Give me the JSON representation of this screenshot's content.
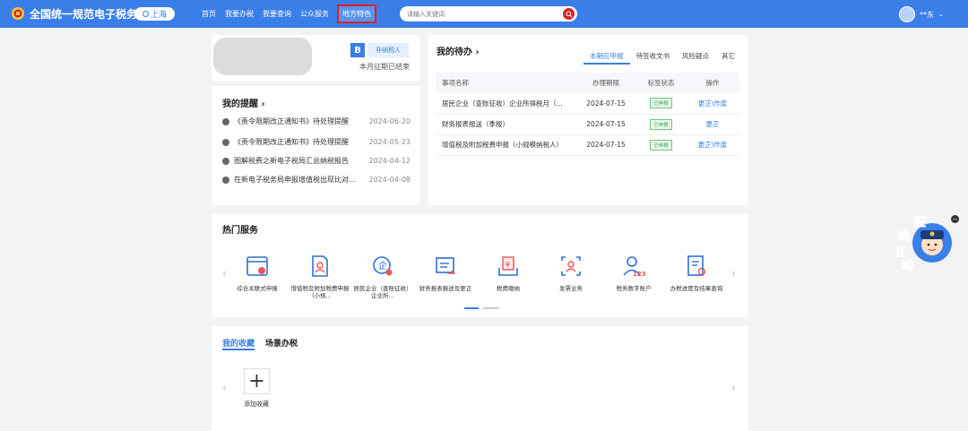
{
  "header": {
    "site_title": "全国统一规范电子税务局",
    "region": "上海",
    "nav": [
      "首页",
      "我要办税",
      "我要查询",
      "公众服务",
      "地方特色"
    ],
    "search_placeholder": "请输入关键词",
    "user_name": "**东"
  },
  "profile": {
    "level": "B",
    "taxpayer_type": "非纳税人",
    "period_status": "本月征期已结束"
  },
  "reminders": {
    "title": "我的提醒 ›",
    "items": [
      {
        "title": "《责令限期改正通知书》待处理提醒",
        "date": "2024-06-20"
      },
      {
        "title": "《责令限期改正通知书》待处理提醒",
        "date": "2024-05-23"
      },
      {
        "title": "图解税费之新电子税局汇总纳税报告",
        "date": "2024-04-12"
      },
      {
        "title": "在新电子税务局申报增值税出现比对...",
        "date": "2024-04-08"
      }
    ]
  },
  "todo": {
    "title": "我的待办 ›",
    "tabs": [
      "本期应申报",
      "待签收文书",
      "风险疑点",
      "其它"
    ],
    "columns": [
      "事项名称",
      "办理期限",
      "标签状态",
      "操作"
    ],
    "rows": [
      {
        "name": "居民企业（查账征收）企业所得税月（...",
        "deadline": "2024-07-15",
        "status": "已申报",
        "action": "更正\\作废"
      },
      {
        "name": "财务报表报送（季报）",
        "deadline": "2024-07-15",
        "status": "已申报",
        "action": "更正"
      },
      {
        "name": "增值税及附加税费申报（小规模纳税人）",
        "deadline": "2024-07-15",
        "status": "已申报",
        "action": "更正\\作废"
      }
    ]
  },
  "hot_services": {
    "title": "热门服务",
    "items": [
      {
        "label": "综合关联式申报",
        "icon": "integrated-declaration-icon"
      },
      {
        "label": "增值税及附加税费申报（小规...",
        "icon": "vat-declaration-icon"
      },
      {
        "label": "居民企业（查账征收）企业所...",
        "icon": "enterprise-income-tax-icon"
      },
      {
        "label": "财务报表报送及更正",
        "icon": "financial-report-icon"
      },
      {
        "label": "税费缴纳",
        "icon": "tax-payment-icon"
      },
      {
        "label": "发票业务",
        "icon": "invoice-icon"
      },
      {
        "label": "税务数字账户",
        "icon": "digital-account-icon"
      },
      {
        "label": "办税进度及结果查询",
        "icon": "progress-query-icon"
      }
    ]
  },
  "favorites": {
    "tabs": [
      "我的收藏",
      "场景办税"
    ],
    "add_label": "添加收藏"
  },
  "float_widget": {
    "chars": [
      "征",
      "纳",
      "互",
      "动"
    ]
  },
  "colors": {
    "brand": "#3a7ee8",
    "highlight": "#e02020",
    "success": "#3aa653"
  }
}
